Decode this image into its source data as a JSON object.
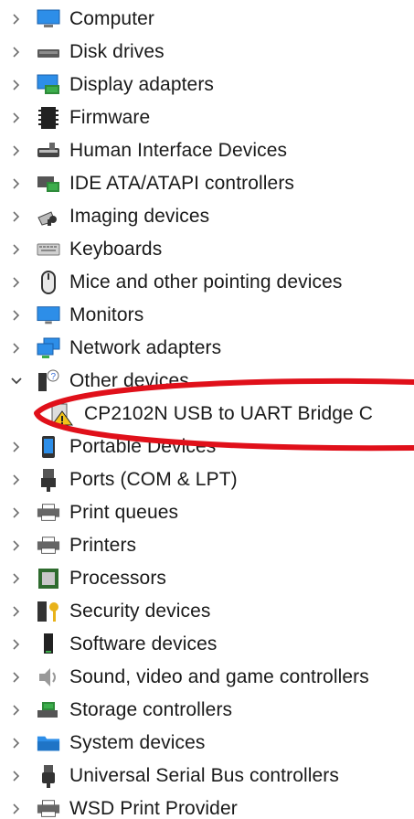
{
  "tree": {
    "items": [
      {
        "label": "Computer",
        "icon": "computer-icon",
        "expanded": false
      },
      {
        "label": "Disk drives",
        "icon": "disk-drive-icon",
        "expanded": false
      },
      {
        "label": "Display adapters",
        "icon": "display-adapter-icon",
        "expanded": false
      },
      {
        "label": "Firmware",
        "icon": "firmware-chip-icon",
        "expanded": false
      },
      {
        "label": "Human Interface Devices",
        "icon": "hid-icon",
        "expanded": false
      },
      {
        "label": "IDE ATA/ATAPI controllers",
        "icon": "ide-controller-icon",
        "expanded": false
      },
      {
        "label": "Imaging devices",
        "icon": "camera-icon",
        "expanded": false
      },
      {
        "label": "Keyboards",
        "icon": "keyboard-icon",
        "expanded": false
      },
      {
        "label": "Mice and other pointing devices",
        "icon": "mouse-icon",
        "expanded": false
      },
      {
        "label": "Monitors",
        "icon": "monitor-icon",
        "expanded": false
      },
      {
        "label": "Network adapters",
        "icon": "network-adapter-icon",
        "expanded": false
      },
      {
        "label": "Other devices",
        "icon": "unknown-device-icon",
        "expanded": true
      },
      {
        "label": "CP2102N USB to UART Bridge C",
        "icon": "warning-device-icon",
        "child": true
      },
      {
        "label": "Portable Devices",
        "icon": "portable-device-icon",
        "expanded": false
      },
      {
        "label": "Ports (COM & LPT)",
        "icon": "port-icon",
        "expanded": false
      },
      {
        "label": "Print queues",
        "icon": "printer-icon",
        "expanded": false
      },
      {
        "label": "Printers",
        "icon": "printer-icon",
        "expanded": false
      },
      {
        "label": "Processors",
        "icon": "processor-icon",
        "expanded": false
      },
      {
        "label": "Security devices",
        "icon": "security-key-icon",
        "expanded": false
      },
      {
        "label": "Software devices",
        "icon": "software-device-icon",
        "expanded": false
      },
      {
        "label": "Sound, video and game controllers",
        "icon": "speaker-icon",
        "expanded": false
      },
      {
        "label": "Storage controllers",
        "icon": "storage-controller-icon",
        "expanded": false
      },
      {
        "label": "System devices",
        "icon": "system-folder-icon",
        "expanded": false
      },
      {
        "label": "Universal Serial Bus controllers",
        "icon": "usb-icon",
        "expanded": false
      },
      {
        "label": "WSD Print Provider",
        "icon": "printer-icon",
        "expanded": false
      }
    ]
  },
  "colors": {
    "text": "#1a1a1a",
    "chevron": "#6e6e6e",
    "annotation": "#e0101a",
    "monitor_blue": "#1e88e5",
    "warning_yellow": "#f2c21b"
  }
}
